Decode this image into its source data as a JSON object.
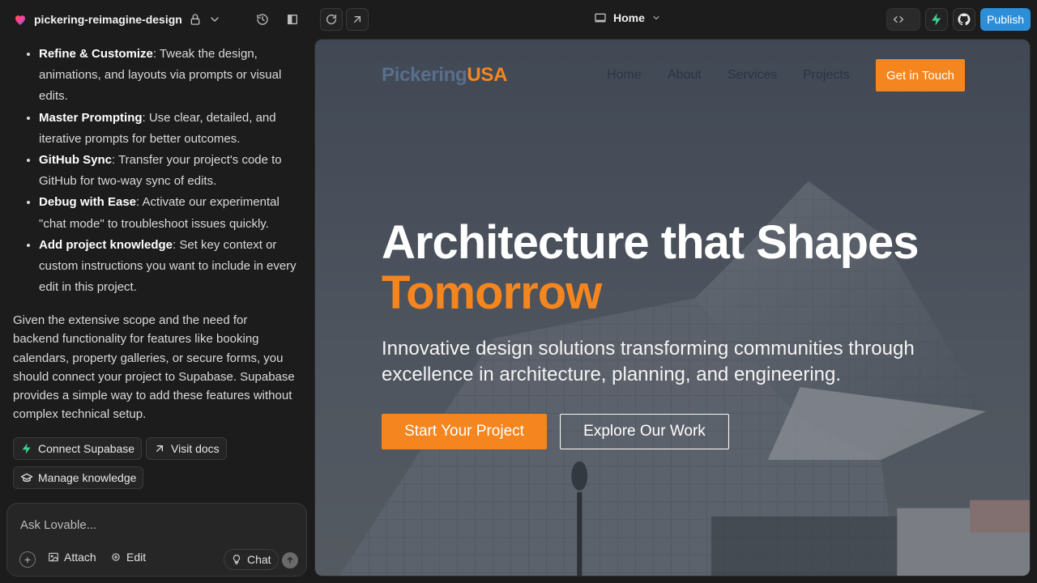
{
  "topbar": {
    "project_name": "pickering-reimagine-design",
    "page_selector": "Home",
    "publish_label": "Publish"
  },
  "chat": {
    "bullets": [
      {
        "title": "Refine & Customize",
        "text": ": Tweak the design, animations, and layouts via prompts or visual edits."
      },
      {
        "title": "Master Prompting",
        "text": ": Use clear, detailed, and iterative prompts for better outcomes."
      },
      {
        "title": "GitHub Sync",
        "text": ": Transfer your project's code to GitHub for two-way sync of edits."
      },
      {
        "title": "Debug with Ease",
        "text": ": Activate our experimental \"chat mode\" to troubleshoot issues quickly."
      },
      {
        "title": "Add project knowledge",
        "text": ": Set key context or custom instructions you want to include in every edit in this project."
      }
    ],
    "paragraph": "Given the extensive scope and the need for backend functionality for features like booking calendars, property galleries, or secure forms, you should connect your project to Supabase. Supabase provides a simple way to add these features without complex technical setup.",
    "actions": {
      "connect": "Connect Supabase",
      "docs": "Visit docs",
      "knowledge": "Manage knowledge"
    },
    "composer": {
      "placeholder": "Ask Lovable...",
      "attach": "Attach",
      "edit": "Edit",
      "chat": "Chat"
    }
  },
  "site": {
    "logo_a": "Pickering",
    "logo_b": "USA",
    "nav": [
      "Home",
      "About",
      "Services",
      "Projects"
    ],
    "cta": "Get in Touch",
    "headline": "Architecture that Shapes",
    "headline_accent": "Tomorrow",
    "subhead": "Innovative design solutions transforming communities through excellence in architecture, planning, and engineering.",
    "primary_button": "Start Your Project",
    "secondary_button": "Explore Our Work"
  },
  "colors": {
    "accent": "#f5861f",
    "publish": "#2d8ed8",
    "supabase": "#3ecf8e"
  }
}
